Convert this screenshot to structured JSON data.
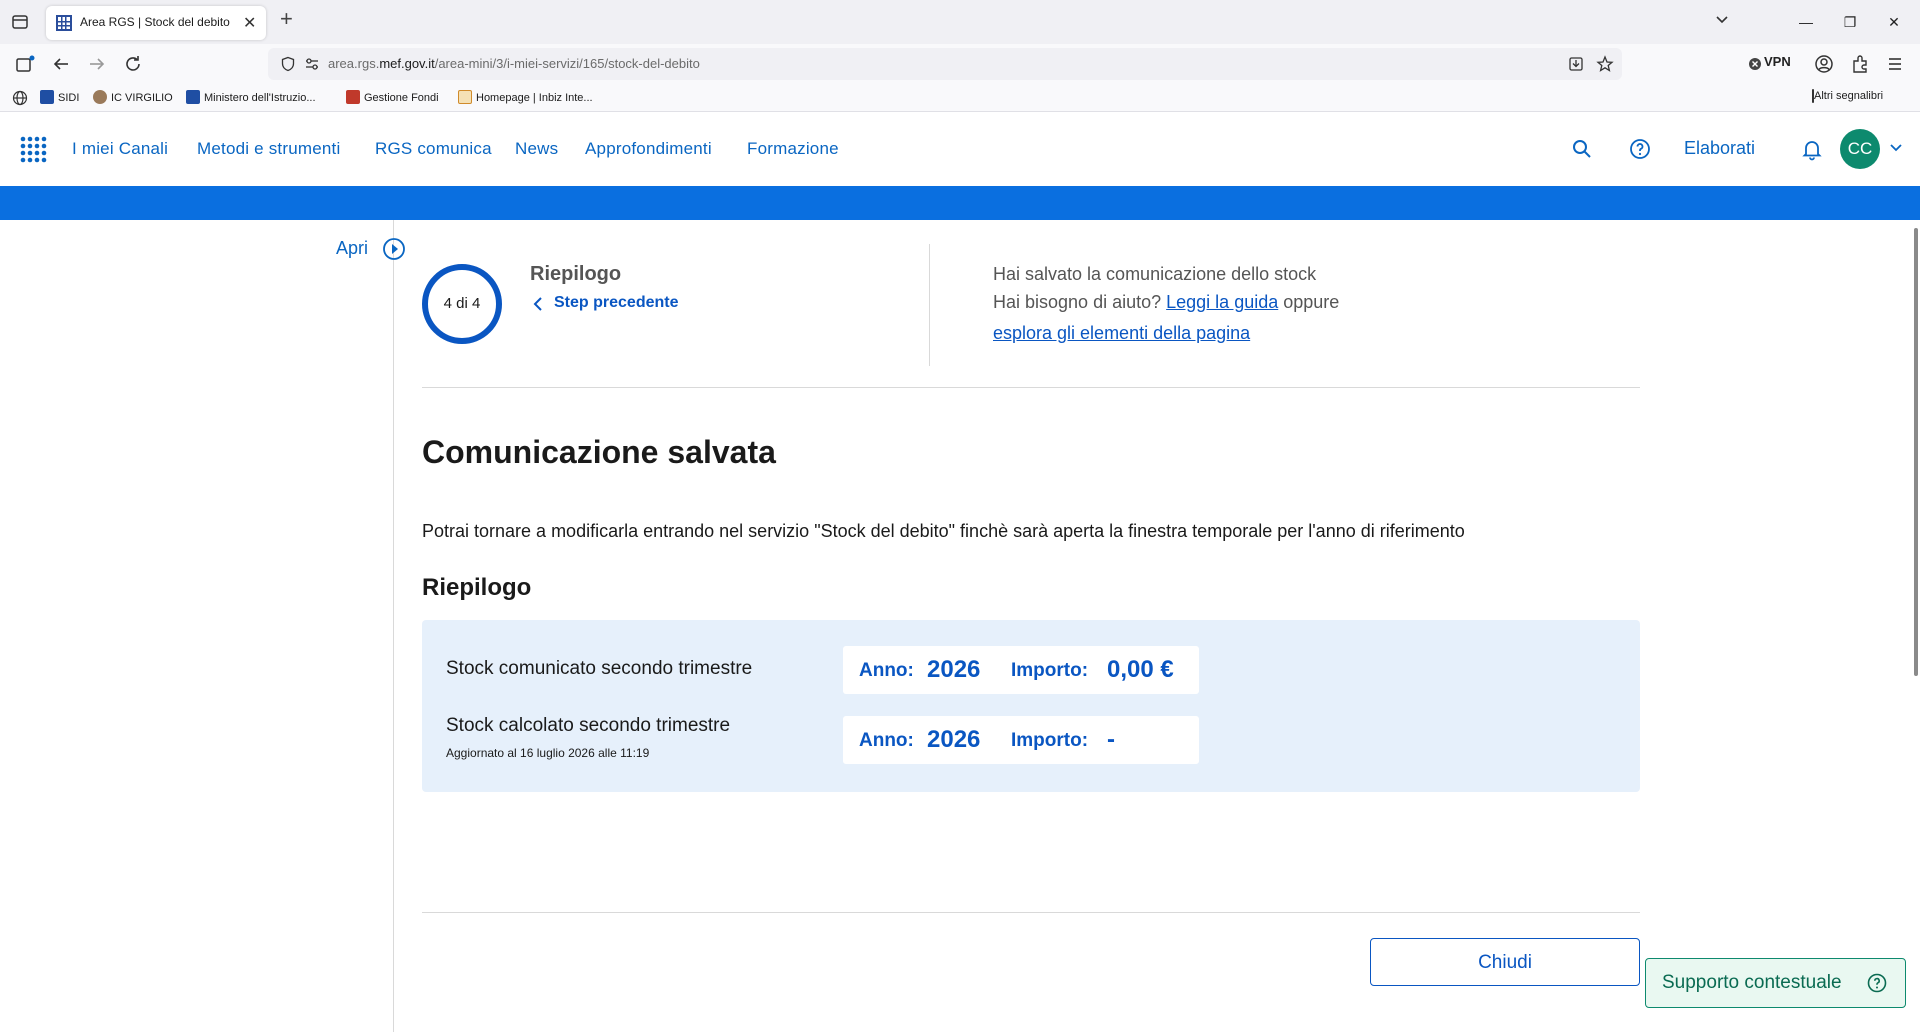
{
  "browser": {
    "tab_title": "Area RGS | Stock del debito",
    "url_prefix": "area.rgs.",
    "url_domain": "mef.gov.it",
    "url_path": "/area-mini/3/i-miei-servizi/165/stock-del-debito",
    "vpn_label": "VPN",
    "bookmarks": [
      "SIDI",
      "IC VIRGILIO",
      "Ministero dell'Istruzio...",
      "Gestione Fondi",
      "Homepage | Inbiz Inte..."
    ],
    "other_bookmarks": "Altri segnalibri"
  },
  "header": {
    "nav": [
      "I miei Canali",
      "Metodi e strumenti",
      "RGS comunica",
      "News",
      "Approfondimenti",
      "Formazione"
    ],
    "elaborati": "Elaborati",
    "avatar_initials": "CC"
  },
  "sidebar": {
    "apri": "Apri"
  },
  "stepper": {
    "progress": "4 di 4",
    "current": 4,
    "total": 4,
    "title": "Riepilogo",
    "back_label": "Step precedente"
  },
  "info": {
    "saved": "Hai salvato la comunicazione dello stock",
    "help_prefix": "Hai bisogno di aiuto?",
    "guide_link": "Leggi la guida",
    "oppure": "oppure",
    "explore_link": "esplora gli elementi della pagina"
  },
  "main": {
    "title": "Comunicazione salvata",
    "description": "Potrai tornare a modificarla entrando nel servizio \"Stock del debito\" finchè sarà aperta la finestra temporale per l'anno di riferimento",
    "section_title": "Riepilogo",
    "rows": [
      {
        "label": "Stock comunicato secondo trimestre",
        "sub": "",
        "anno_label": "Anno:",
        "anno": "2026",
        "importo_label": "Importo:",
        "importo": "0,00 €"
      },
      {
        "label": "Stock calcolato secondo trimestre",
        "sub": "Aggiornato al 16 luglio 2026 alle 11:19",
        "anno_label": "Anno:",
        "anno": "2026",
        "importo_label": "Importo:",
        "importo": "-"
      }
    ],
    "close_label": "Chiudi",
    "support_label": "Supporto contestuale"
  },
  "colors": {
    "primary": "#0a56c2",
    "band": "#0a6fe0",
    "avatar": "#0d8a6e",
    "summary_bg": "#e6f0fb"
  }
}
